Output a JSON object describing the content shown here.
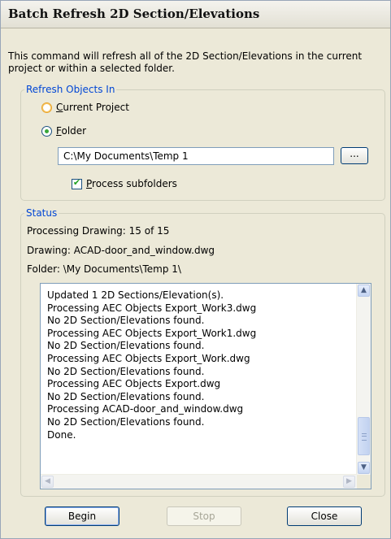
{
  "window": {
    "title": "Batch Refresh 2D Section/Elevations"
  },
  "intro": {
    "text": "This command will refresh all of the 2D Section/Elevations in the current project or within a selected folder."
  },
  "refresh_group": {
    "legend": "Refresh Objects In",
    "options": [
      {
        "label": "Current Project",
        "checked": false
      },
      {
        "label": "Folder",
        "checked": true
      }
    ],
    "folder_path": "C:\\My Documents\\Temp 1",
    "browse_label": "...",
    "subfolders_label": "Process subfolders",
    "subfolders_checked": true
  },
  "status_group": {
    "legend": "Status",
    "processing": "Processing Drawing: 15 of 15",
    "drawing": "Drawing: ACAD-door_and_window.dwg",
    "folder": "Folder: \\My Documents\\Temp 1\\",
    "log": [
      "Updated 1 2D Sections/Elevation(s).",
      "Processing AEC Objects Export_Work3.dwg",
      "No 2D Section/Elevations found.",
      "Processing AEC Objects Export_Work1.dwg",
      "No 2D Section/Elevations found.",
      "Processing AEC Objects Export_Work.dwg",
      "No 2D Section/Elevations found.",
      "Processing AEC Objects Export.dwg",
      "No 2D Section/Elevations found.",
      "Processing ACAD-door_and_window.dwg",
      "No 2D Section/Elevations found.",
      "Done."
    ]
  },
  "buttons": {
    "begin": "Begin",
    "stop": "Stop",
    "close": "Close"
  },
  "colors": {
    "legend": "#0046d5",
    "dialog_bg": "#ece9d8",
    "radio_selected": "#3aa73a"
  }
}
